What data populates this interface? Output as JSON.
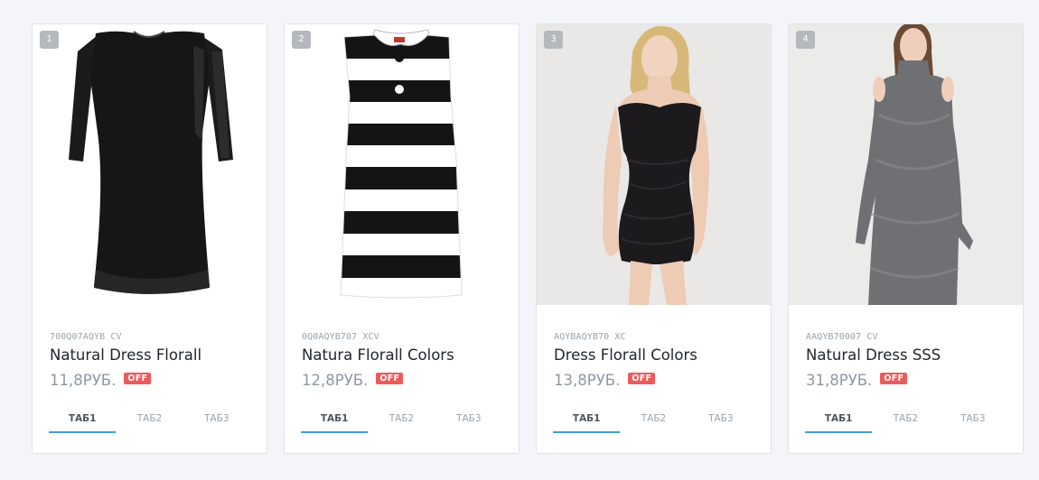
{
  "products": [
    {
      "badge": "1",
      "sku": "700Q07AQYB CV",
      "name": "Natural Dress Florall",
      "price": "11,8РУБ.",
      "off_label": "OFF",
      "image": "black-sleeved-dress",
      "tabs": [
        "ТАБ1",
        "ТАБ2",
        "ТАБ3"
      ],
      "active_tab": 0
    },
    {
      "badge": "2",
      "sku": "0Q0AQYB707 XCV",
      "name": "Natura Florall Colors",
      "price": "12,8РУБ.",
      "off_label": "OFF",
      "image": "striped-collar-dress",
      "tabs": [
        "ТАБ1",
        "ТАБ2",
        "ТАБ3"
      ],
      "active_tab": 0
    },
    {
      "badge": "3",
      "sku": "AQYBAQYB70 XC",
      "name": "Dress Florall Colors",
      "price": "13,8РУБ.",
      "off_label": "OFF",
      "image": "strapless-black-dress-model",
      "tabs": [
        "ТАБ1",
        "ТАБ2",
        "ТАБ3"
      ],
      "active_tab": 0
    },
    {
      "badge": "4",
      "sku": "AAQYB70007 CV",
      "name": "Natural Dress SSS",
      "price": "31,8РУБ.",
      "off_label": "OFF",
      "image": "grey-cold-shoulder-dress-model",
      "tabs": [
        "ТАБ1",
        "ТАБ2",
        "ТАБ3"
      ],
      "active_tab": 0
    }
  ],
  "colors": {
    "off_badge": "#ec5b5b",
    "tab_underline": "#3f9ed6"
  }
}
